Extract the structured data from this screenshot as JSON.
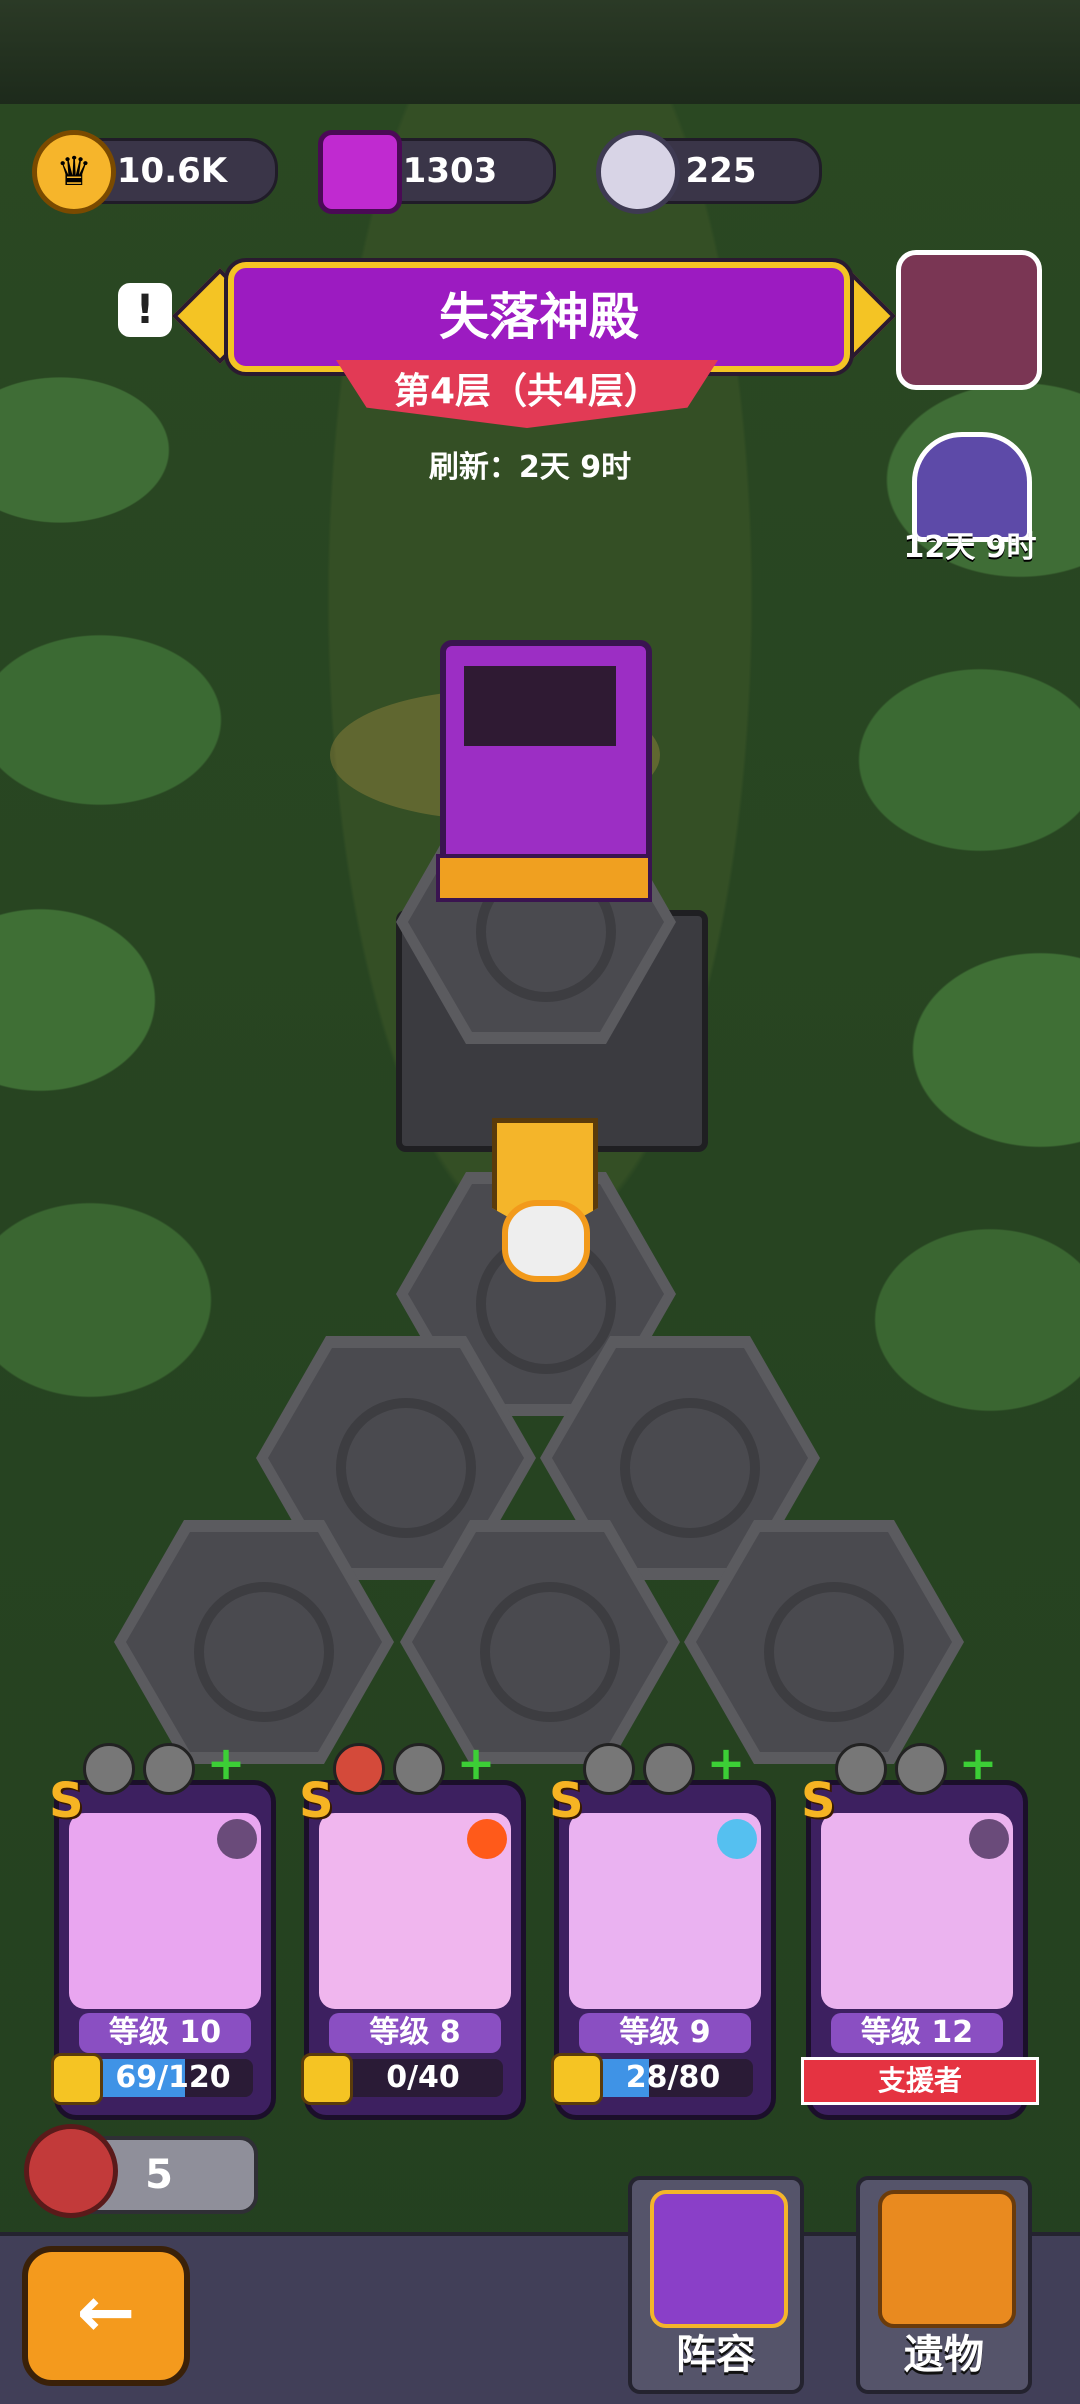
{
  "resources": {
    "crowns": "10.6K",
    "gems": "1303",
    "souls": "225"
  },
  "stage": {
    "title": "失落神殿",
    "floor": "第4层（共4层）",
    "refresh": "刷新：2天 9时"
  },
  "event": {
    "timer": "12天 9时"
  },
  "heroes": [
    {
      "rank": "S",
      "level": "等级 10",
      "progress": "69/120",
      "progress_fraction": 0.575,
      "element_icon": "bat-icon",
      "art": "blue-vampire"
    },
    {
      "rank": "S",
      "level": "等级 8",
      "progress": "0/40",
      "progress_fraction": 0.0,
      "element_icon": "fire-icon",
      "art": "red-dragon"
    },
    {
      "rank": "S",
      "level": "等级 9",
      "progress": "28/80",
      "progress_fraction": 0.35,
      "element_icon": "water-icon",
      "art": "ice-knight"
    },
    {
      "rank": "S",
      "level": "等级 12",
      "support": "支援者",
      "element_icon": "bat-icon",
      "art": "dark-jester"
    }
  ],
  "meat_count": "5",
  "nav": {
    "lineup": "阵容",
    "relics": "遗物"
  },
  "colors": {
    "banner": "#9c1bc1",
    "gold": "#f4c424",
    "ribbon": "#e23a55",
    "card": "#3d2060"
  }
}
